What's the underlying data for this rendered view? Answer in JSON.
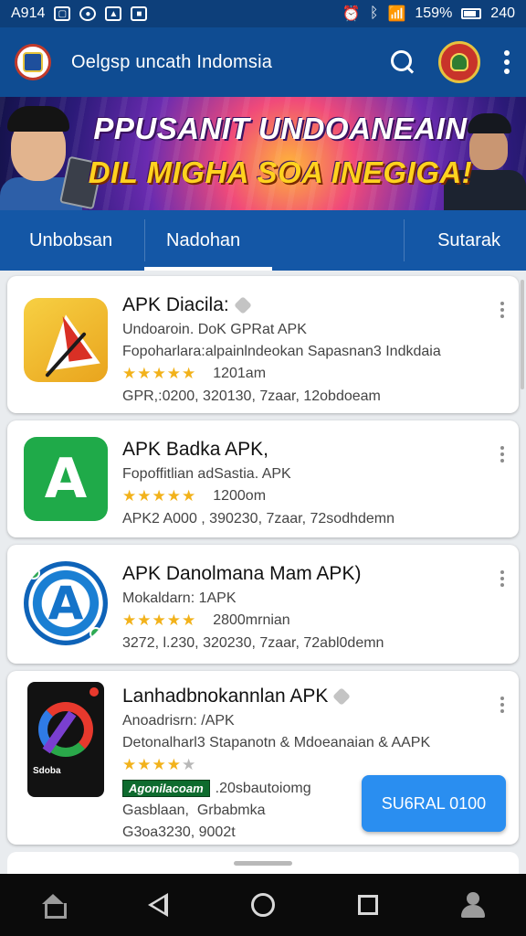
{
  "status_bar": {
    "left_text": "A914",
    "right_text": "159%",
    "time": "240",
    "icons": [
      "notification-icon",
      "circle-notification-icon",
      "image-notification-icon",
      "gallery-notification-icon",
      "alarm-icon",
      "bluetooth-icon",
      "wifi-icon",
      "battery-icon"
    ]
  },
  "app_bar": {
    "title": "Oelgsp uncath Indomsia",
    "icons": [
      "app-logo-icon",
      "search-icon",
      "emblem-icon",
      "more-vert-icon"
    ]
  },
  "banner": {
    "line1": "PPUSANIT UNDOANEAIN",
    "line2": "DIL MIGHA SOA INEGIGA!"
  },
  "tabs": [
    {
      "label": "Unbobsan"
    },
    {
      "label": "Nadohan"
    },
    {
      "label": "Sutarak"
    }
  ],
  "apps": [
    {
      "title": "APK Diacila:",
      "line1": "Undoaroin. DoK GPRat APK",
      "line2": "Fopoharlara:alpainlndeokan Sapasnan3 Indkdaia",
      "rating_text": "1201am",
      "stars": 5,
      "meta": "GPR,:0200,  320130,  7zaar,  12obdoeam"
    },
    {
      "title": "APK Badka APK,",
      "line1": "Fopoffitlian adSastia. APK",
      "rating_text": "1200om",
      "stars": 5,
      "meta": "APK2 A000 ,  390230,  7zaar,  72sodhdemn"
    },
    {
      "title": "APK Danolmana Mam APK)",
      "line1": "Mokaldarn: 1APK",
      "rating_text": "2800mrnian",
      "stars": 5,
      "meta": "3272, l.230,  320230,  7zaar,  72abl0demn"
    },
    {
      "title": "Lanhadbnokannlan APK",
      "line1": "Anoadrisrn: /APK",
      "line2": "Detonalharl3 Stapanotn & Mdoeanaian & AAPK",
      "tag": "Agonilacoam",
      "line3": ".20sbautoiomg",
      "line4a": "Gasblaan,",
      "line4b": "Grbabmka",
      "line5": "G3oa3230,  9002t",
      "stars": 4,
      "icon_label": "Sdoba",
      "button_label": "SU6RAL 0100"
    }
  ],
  "accent_colors": {
    "status_bar": "#0d3f7a",
    "app_bar": "#0f4c92",
    "tab_bar": "#1457a6",
    "star": "#f2b21b",
    "action_button": "#2a8ef0"
  }
}
